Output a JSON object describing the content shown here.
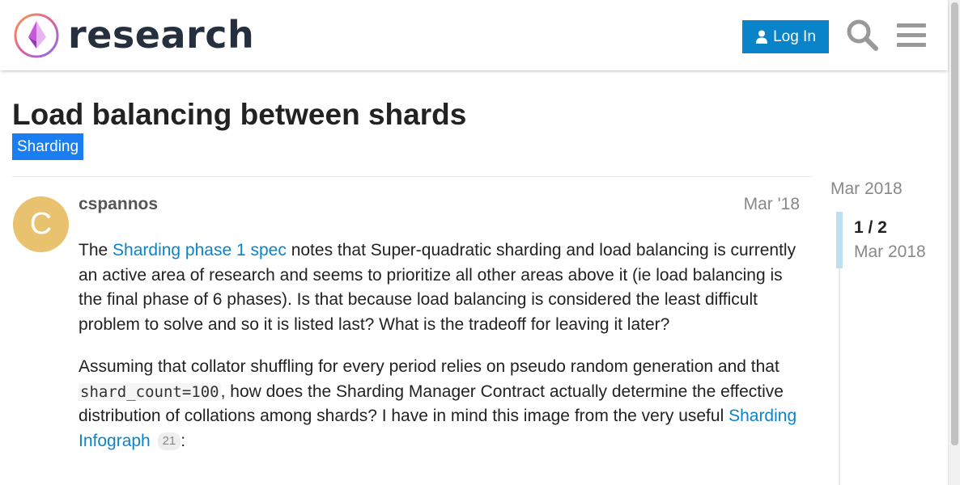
{
  "header": {
    "site_name": "research",
    "login_label": "Log In"
  },
  "topic": {
    "title": "Load balancing between shards",
    "category": "Sharding"
  },
  "post": {
    "avatar_letter": "C",
    "username": "cspannos",
    "date": "Mar '18",
    "p1_before": "The ",
    "p1_link": "Sharding phase 1 spec",
    "p1_after": " notes that Super-quadratic sharding and load balancing is currently an active area of research and seems to prioritize all other areas above it (ie load balancing is the final phase of 6 phases). Is that because load balancing is considered the least difficult problem to solve and so it is listed last? What is the tradeoff for leaving it later?",
    "p2_before": "Assuming that collator shuffling for every period relies on pseudo random generation and that ",
    "p2_code": "shard_count=100",
    "p2_middle": ", how does the Sharding Manager Contract actually determine the effective distribution of collations among shards? I have in mind this image from the very useful ",
    "p2_link": "Sharding Infograph",
    "p2_link_clicks": "21",
    "p2_after": ":"
  },
  "timeline": {
    "start_date": "Mar 2018",
    "progress": "1 / 2",
    "current_date": "Mar 2018"
  },
  "colors": {
    "accent": "#0a84c9",
    "category": "#1a7ef2",
    "avatar": "#e8c26e",
    "title_text": "#222222"
  },
  "icons": [
    "logo-icon",
    "user-icon",
    "search-icon",
    "hamburger-menu-icon"
  ]
}
